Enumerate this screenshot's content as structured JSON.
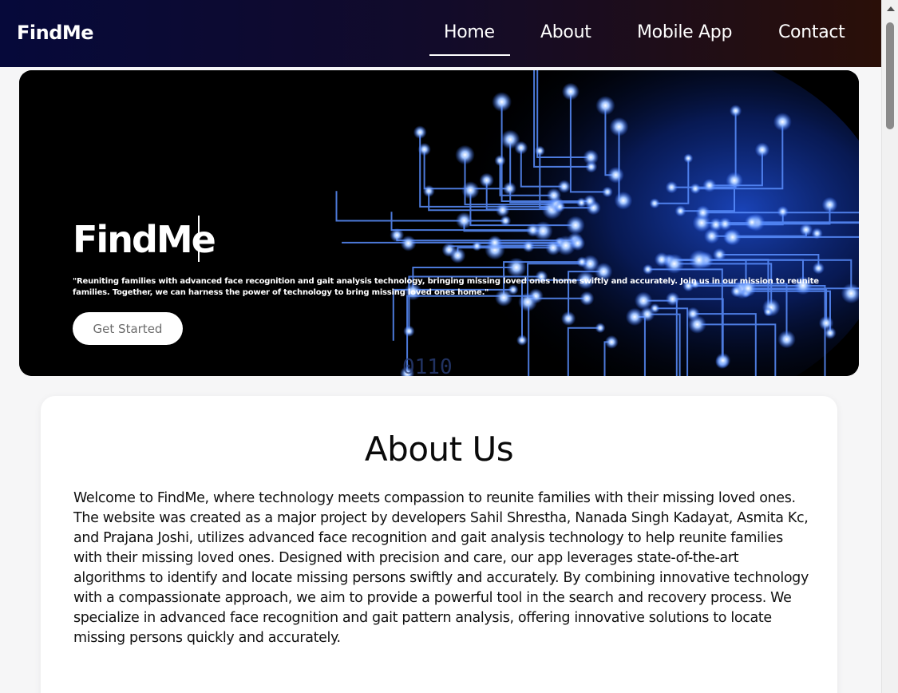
{
  "navbar": {
    "brand": "FindMe",
    "items": [
      {
        "label": "Home",
        "active": true
      },
      {
        "label": "About"
      },
      {
        "label": "Mobile App"
      },
      {
        "label": "Contact"
      }
    ]
  },
  "hero": {
    "title": "FindMe",
    "description": "\"Reuniting families with advanced face recognition and gait analysis technology, bringing missing loved ones home swiftly and accurately. Join us in our mission to reunite families. Together, we can harness the power of technology to bring missing loved ones home.\"",
    "button_label": "Get Started",
    "binary_text": "0110"
  },
  "about": {
    "title": "About Us",
    "body": "Welcome to FindMe, where technology meets compassion to reunite families with their missing loved ones. The website was created as a major project by developers Sahil Shrestha, Nanada Singh Kadayat, Asmita Kc, and Prajana Joshi, utilizes advanced face recognition and gait analysis technology to help reunite families with their missing loved ones. Designed with precision and care, our app leverages state-of-the-art algorithms to identify and locate missing persons swiftly and accurately. By combining innovative technology with a compassionate approach, we aim to provide a powerful tool in the search and recovery process. We specialize in advanced face recognition and gait pattern analysis, offering innovative solutions to locate missing persons quickly and accurately."
  },
  "colors": {
    "nav_start": "#06093a",
    "nav_end": "#2a0f08",
    "circuit_glow": "#2f6bff"
  }
}
